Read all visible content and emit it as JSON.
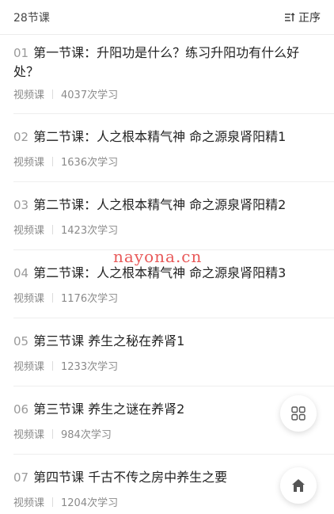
{
  "header": {
    "lesson_count": "28节课",
    "sort_label": "正序",
    "sort_icon": "sort-icon"
  },
  "lessons": [
    {
      "num": "01",
      "title": "第一节课：升阳功是什么？练习升阳功有什么好处？",
      "type": "视频课",
      "views": "4037次学习"
    },
    {
      "num": "02",
      "title": "第二节课：人之根本精气神 命之源泉肾阳精1",
      "type": "视频课",
      "views": "1636次学习"
    },
    {
      "num": "03",
      "title": "第二节课：人之根本精气神 命之源泉肾阳精2",
      "type": "视频课",
      "views": "1423次学习"
    },
    {
      "num": "04",
      "title": "第二节课：人之根本精气神 命之源泉肾阳精3",
      "type": "视频课",
      "views": "1176次学习"
    },
    {
      "num": "05",
      "title": "第三节课 养生之秘在养肾1",
      "type": "视频课",
      "views": "1233次学习"
    },
    {
      "num": "06",
      "title": "第三节课 养生之谜在养肾2",
      "type": "视频课",
      "views": "984次学习"
    },
    {
      "num": "07",
      "title": "第四节课 千古不传之房中养生之要",
      "type": "视频课",
      "views": "1204次学习"
    }
  ],
  "watermark": "nayona.cn",
  "fabs": {
    "grid_icon": "grid-icon",
    "home_icon": "home-icon"
  }
}
